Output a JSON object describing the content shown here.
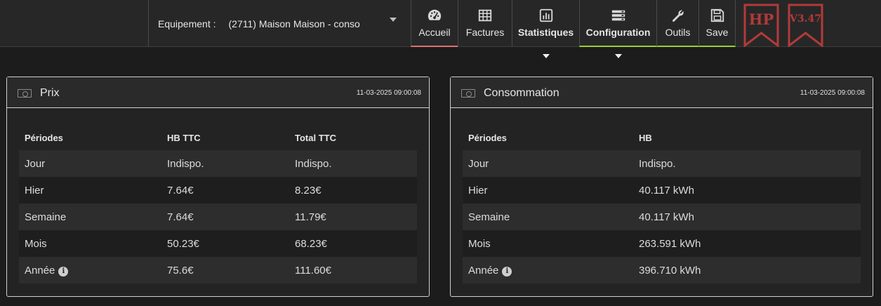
{
  "header": {
    "equipment_label": "Equipement :",
    "equipment_value": "(2711) Maison Maison - conso",
    "nav": {
      "accueil": "Accueil",
      "factures": "Factures",
      "statistiques": "Statistiques",
      "configuration": "Configuration",
      "outils": "Outils",
      "save": "Save"
    },
    "badge_hp": "HP",
    "badge_version": "V3.47",
    "accent_red": "#e07070",
    "accent_green": "#9acd32",
    "badge_color": "#b33a3a"
  },
  "prix": {
    "title": "Prix",
    "timestamp": "11-03-2025 09:00:08",
    "columns": [
      "Périodes",
      "HB TTC",
      "Total TTC"
    ],
    "rows": [
      {
        "period": "Jour",
        "hb": "Indispo.",
        "total": "Indispo."
      },
      {
        "period": "Hier",
        "hb": "7.64€",
        "total": "8.23€"
      },
      {
        "period": "Semaine",
        "hb": "7.64€",
        "total": "11.79€"
      },
      {
        "period": "Mois",
        "hb": "50.23€",
        "total": "68.23€"
      },
      {
        "period": "Année",
        "hb": "75.6€",
        "total": "111.60€"
      }
    ]
  },
  "consommation": {
    "title": "Consommation",
    "timestamp": "11-03-2025 09:00:08",
    "columns": [
      "Périodes",
      "HB"
    ],
    "rows": [
      {
        "period": "Jour",
        "hb": "Indispo."
      },
      {
        "period": "Hier",
        "hb": "40.117 kWh"
      },
      {
        "period": "Semaine",
        "hb": "40.117 kWh"
      },
      {
        "period": "Mois",
        "hb": "263.591 kWh"
      },
      {
        "period": "Année",
        "hb": "396.710 kWh"
      }
    ]
  },
  "info_glyph": "i"
}
